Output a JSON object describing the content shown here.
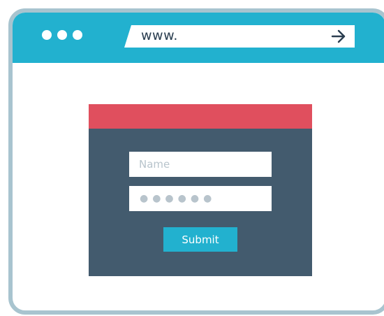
{
  "browser": {
    "address_text": "www.",
    "window_dot_count": 3,
    "go_icon": "arrow-right-icon"
  },
  "login_form": {
    "name_placeholder": "Name",
    "password_mask": "●●●●●●",
    "submit_label": "Submit"
  },
  "colors": {
    "titlebar": "#22b1cf",
    "window_border": "#a8c4cf",
    "form_header": "#e04f5e",
    "form_body": "#435b6e",
    "submit_button": "#22b1cf"
  }
}
